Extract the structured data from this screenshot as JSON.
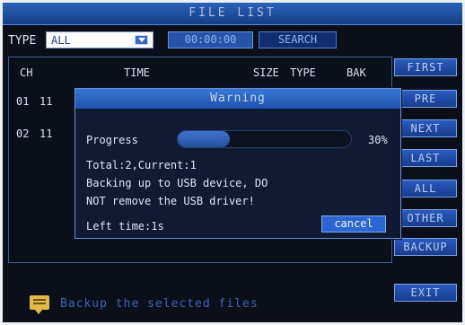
{
  "window": {
    "title": "FILE LIST"
  },
  "filter": {
    "type_label": "TYPE",
    "type_value": "ALL",
    "time_value": "00:00:00",
    "search_label": "SEARCH"
  },
  "list": {
    "columns": {
      "ch": "CH",
      "time": "TIME",
      "size": "SIZE",
      "type": "TYPE",
      "bak": "BAK"
    },
    "rows": [
      {
        "ch": "01",
        "time_prefix": "11"
      },
      {
        "ch": "02",
        "time_prefix": "11"
      }
    ]
  },
  "side_buttons": [
    {
      "label": "FIRST"
    },
    {
      "label": "PRE"
    },
    {
      "label": "NEXT"
    },
    {
      "label": "LAST"
    },
    {
      "label": "ALL"
    },
    {
      "label": "OTHER"
    },
    {
      "label": "BACKUP"
    }
  ],
  "exit_label": "EXIT",
  "status": {
    "icon": "chat-icon",
    "text": "Backup the selected files"
  },
  "dialog": {
    "title": "Warning",
    "progress_label": "Progress",
    "progress_value": 0.3,
    "progress_text": "30%",
    "total_line": "Total:2,Current:1",
    "message_line1": "Backing up to USB device, DO",
    "message_line2": "NOT remove the USB driver!",
    "left_time": "Left time:1s",
    "cancel_label": "cancel"
  }
}
